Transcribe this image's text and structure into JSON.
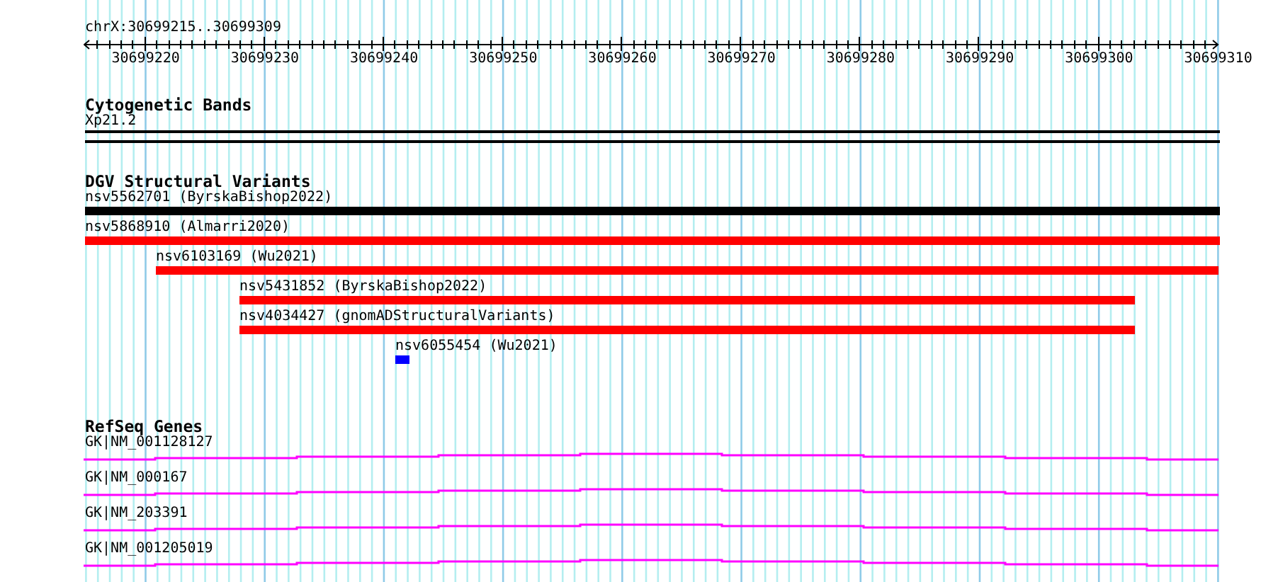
{
  "region": {
    "label": "chrX:30699215..30699309"
  },
  "ruler": {
    "ticks": [
      "30699220",
      "30699230",
      "30699240",
      "30699250",
      "30699260",
      "30699270",
      "30699280",
      "30699290",
      "30699300",
      "30699310"
    ]
  },
  "tracks": [
    {
      "kind": "bands",
      "title": "Cytogenetic Bands",
      "items": [
        {
          "label": "Xp21.2"
        }
      ]
    },
    {
      "kind": "variants",
      "title": "DGV Structural Variants",
      "items": [
        {
          "label": "nsv5562701 (ByrskaBishop2022)",
          "color": "#000000"
        },
        {
          "label": "nsv5868910 (Almarri2020)",
          "color": "#ff0000"
        },
        {
          "label": "nsv6103169 (Wu2021)",
          "color": "#ff0000"
        },
        {
          "label": "nsv5431852 (ByrskaBishop2022)",
          "color": "#ff0000"
        },
        {
          "label": "nsv4034427 (gnomADStructuralVariants)",
          "color": "#ff0000"
        },
        {
          "label": "nsv6055454 (Wu2021)",
          "color": "#0000ff"
        }
      ]
    },
    {
      "kind": "genes",
      "title": "RefSeq Genes",
      "items": [
        {
          "label": "GK|NM_001128127"
        },
        {
          "label": "GK|NM_000167"
        },
        {
          "label": "GK|NM_203391"
        },
        {
          "label": "GK|NM_001205019"
        }
      ]
    }
  ]
}
